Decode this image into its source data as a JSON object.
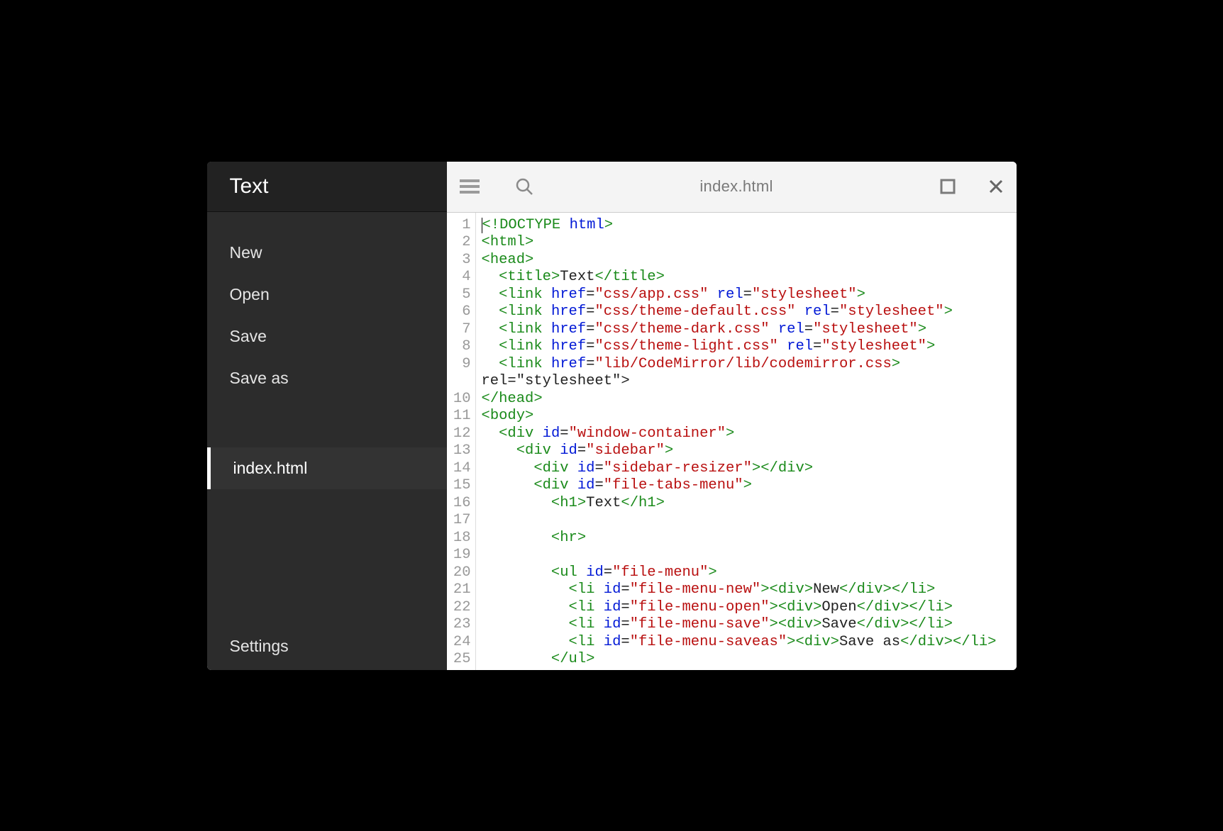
{
  "sidebar": {
    "title": "Text",
    "menu": {
      "new": "New",
      "open": "Open",
      "save": "Save",
      "saveas": "Save as"
    },
    "tabs": [
      {
        "label": "index.html"
      }
    ],
    "settings": "Settings"
  },
  "toolbar": {
    "filename": "index.html"
  },
  "code_lines": [
    "<!DOCTYPE html>",
    "<html>",
    "<head>",
    "  <title>Text</title>",
    "  <link href=\"css/app.css\" rel=\"stylesheet\">",
    "  <link href=\"css/theme-default.css\" rel=\"stylesheet\">",
    "  <link href=\"css/theme-dark.css\" rel=\"stylesheet\">",
    "  <link href=\"css/theme-light.css\" rel=\"stylesheet\">",
    "  <link href=\"lib/CodeMirror/lib/codemirror.css\" rel=\"stylesheet\">",
    "</head>",
    "<body>",
    "  <div id=\"window-container\">",
    "    <div id=\"sidebar\">",
    "      <div id=\"sidebar-resizer\"></div>",
    "      <div id=\"file-tabs-menu\">",
    "        <h1>Text</h1>",
    "",
    "        <hr>",
    "",
    "        <ul id=\"file-menu\">",
    "          <li id=\"file-menu-new\"><div>New</div></li>",
    "          <li id=\"file-menu-open\"><div>Open</div></li>",
    "          <li id=\"file-menu-save\"><div>Save</div></li>",
    "          <li id=\"file-menu-saveas\"><div>Save as</div></li>",
    "        </ul>"
  ]
}
